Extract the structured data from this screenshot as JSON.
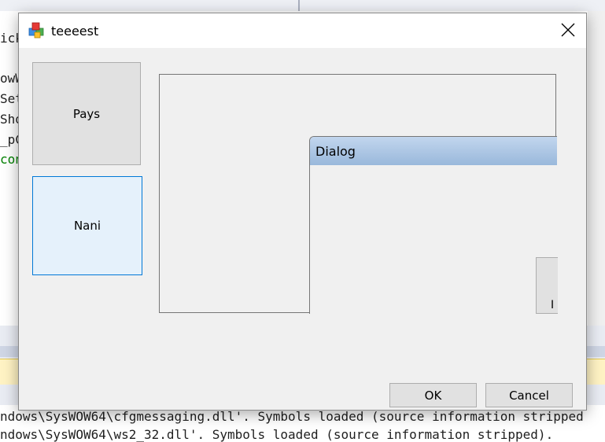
{
  "background": {
    "code_lines": [
      {
        "text": "ick",
        "color": "#1e1e1e"
      },
      {
        "text": "owWi",
        "color": "#1e1e1e"
      },
      {
        "text": "Set",
        "color": "#1e1e1e"
      },
      {
        "text": "Sho",
        "color": "#1e1e1e"
      },
      {
        "text": "_pC",
        "color": "#1e1e1e"
      },
      {
        "text": "con",
        "color": "#008000"
      }
    ],
    "output_lines": [
      "ndows\\SysWOW64\\cfgmessaging.dll'. Symbols loaded (source information stripped",
      "ndows\\SysWOW64\\ws2_32.dll'. Symbols loaded (source information stripped)."
    ]
  },
  "dialog": {
    "title": "teeeest",
    "close_icon": "close-icon",
    "tiles": [
      {
        "label": "Pays"
      },
      {
        "label": "Nani"
      }
    ],
    "inner_dialog": {
      "title": "Dialog",
      "button_label": "I"
    },
    "buttons": {
      "ok_label": "OK",
      "cancel_label": "Cancel"
    }
  }
}
